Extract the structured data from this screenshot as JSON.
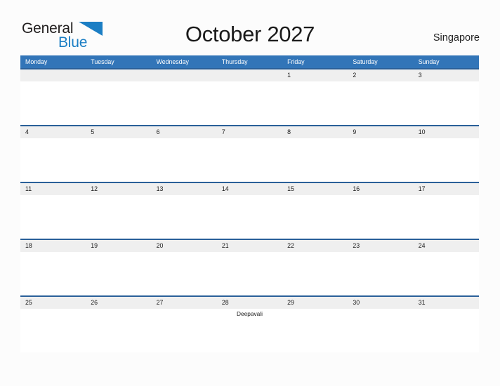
{
  "brand": {
    "name_part1": "General",
    "name_part2": "Blue",
    "flag_icon": "blue-flag-triangle-icon",
    "color_primary": "#1b7ec4",
    "color_text": "#221f1f"
  },
  "header": {
    "title": "October 2027",
    "location": "Singapore"
  },
  "calendar": {
    "month": "October",
    "year": "2027",
    "header_bg": "#3275b8",
    "date_band_bg": "#efefef",
    "row_rule_color": "#2a6099",
    "weekdays": [
      "Monday",
      "Tuesday",
      "Wednesday",
      "Thursday",
      "Friday",
      "Saturday",
      "Sunday"
    ],
    "weeks": [
      {
        "days": [
          {
            "date": "",
            "event": ""
          },
          {
            "date": "",
            "event": ""
          },
          {
            "date": "",
            "event": ""
          },
          {
            "date": "",
            "event": ""
          },
          {
            "date": "1",
            "event": ""
          },
          {
            "date": "2",
            "event": ""
          },
          {
            "date": "3",
            "event": ""
          }
        ]
      },
      {
        "days": [
          {
            "date": "4",
            "event": ""
          },
          {
            "date": "5",
            "event": ""
          },
          {
            "date": "6",
            "event": ""
          },
          {
            "date": "7",
            "event": ""
          },
          {
            "date": "8",
            "event": ""
          },
          {
            "date": "9",
            "event": ""
          },
          {
            "date": "10",
            "event": ""
          }
        ]
      },
      {
        "days": [
          {
            "date": "11",
            "event": ""
          },
          {
            "date": "12",
            "event": ""
          },
          {
            "date": "13",
            "event": ""
          },
          {
            "date": "14",
            "event": ""
          },
          {
            "date": "15",
            "event": ""
          },
          {
            "date": "16",
            "event": ""
          },
          {
            "date": "17",
            "event": ""
          }
        ]
      },
      {
        "days": [
          {
            "date": "18",
            "event": ""
          },
          {
            "date": "19",
            "event": ""
          },
          {
            "date": "20",
            "event": ""
          },
          {
            "date": "21",
            "event": ""
          },
          {
            "date": "22",
            "event": ""
          },
          {
            "date": "23",
            "event": ""
          },
          {
            "date": "24",
            "event": ""
          }
        ]
      },
      {
        "days": [
          {
            "date": "25",
            "event": ""
          },
          {
            "date": "26",
            "event": ""
          },
          {
            "date": "27",
            "event": ""
          },
          {
            "date": "28",
            "event": "Deepavali"
          },
          {
            "date": "29",
            "event": ""
          },
          {
            "date": "30",
            "event": ""
          },
          {
            "date": "31",
            "event": ""
          }
        ]
      }
    ]
  }
}
